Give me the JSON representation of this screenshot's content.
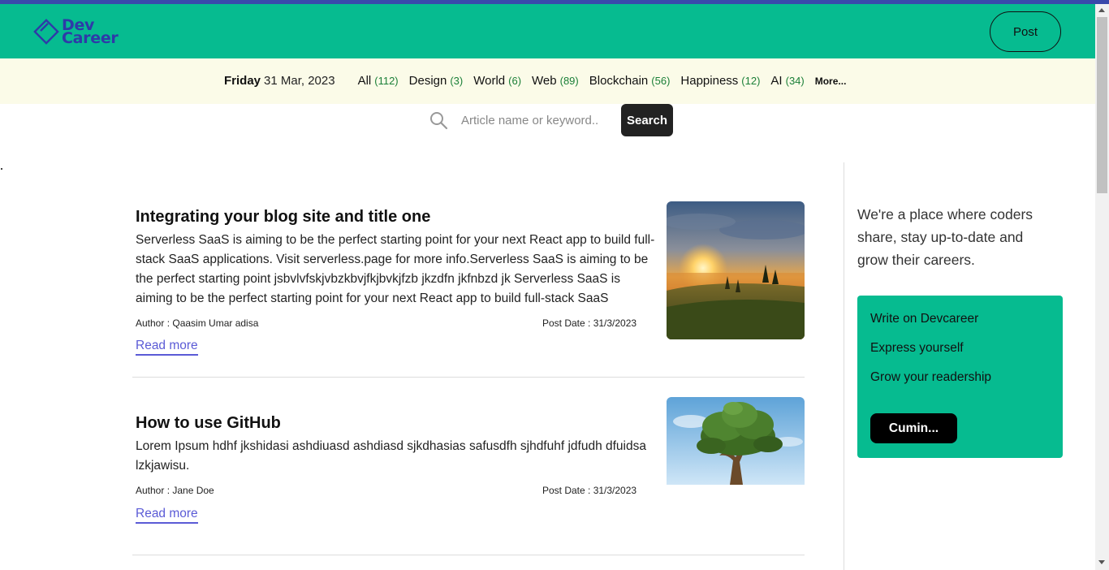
{
  "brand": {
    "line1": "Dev",
    "line2": "Career"
  },
  "header": {
    "post_label": "Post"
  },
  "datebar": {
    "day": "Friday",
    "date": "31 Mar, 2023",
    "categories": [
      {
        "label": "All",
        "count": "(112)"
      },
      {
        "label": "Design",
        "count": "(3)"
      },
      {
        "label": "World",
        "count": "(6)"
      },
      {
        "label": "Web",
        "count": "(89)"
      },
      {
        "label": "Blockchain",
        "count": "(56)"
      },
      {
        "label": "Happiness",
        "count": "(12)"
      },
      {
        "label": "AI",
        "count": "(34)"
      }
    ],
    "more_label": "More..."
  },
  "search": {
    "placeholder": "Article name or keyword..",
    "button_label": "Search"
  },
  "articles": [
    {
      "title": "Integrating your blog site and title one",
      "excerpt": "Serverless SaaS is aiming to be the perfect starting point for your next React app to build full-stack SaaS applications. Visit serverless.page for more info.Serverless SaaS is aiming to be the perfect starting point jsbvlvfskjvbzkbvjfkjbvkjfzb jkzdfn jkfnbzd jk Serverless SaaS is aiming to be the perfect starting point for your next React app to build full-stack SaaS",
      "author": "Author : Qaasim Umar adisa",
      "post_date": "Post Date : 31/3/2023",
      "read_more": "Read more"
    },
    {
      "title": "How to use GitHub",
      "excerpt": "Lorem Ipsum hdhf jkshidasi ashdiuasd ashdiasd sjkdhasias safusdfh sjhdfuhf jdfudh dfuidsa lzkjawisu.",
      "author": "Author : Jane Doe",
      "post_date": "Post Date : 31/3/2023",
      "read_more": "Read more"
    }
  ],
  "sidebar": {
    "tagline": "We're a place where coders share, stay up-to-date and grow their careers.",
    "cta_items": [
      "Write on Devcareer",
      "Express yourself",
      "Grow your readership"
    ],
    "cta_button": "Cumin..."
  },
  "colors": {
    "header_bg": "#06bb90",
    "top_stripe": "#3949ab",
    "brand": "#2e3aa8",
    "category_bar_bg": "#fbfbe8",
    "count_green": "#1a7f37",
    "link": "#5b5bd6"
  },
  "icons": {
    "logo": "diamond-logo-icon",
    "search": "search-icon",
    "scroll_up": "arrow-up-icon",
    "scroll_down": "arrow-down-icon"
  }
}
